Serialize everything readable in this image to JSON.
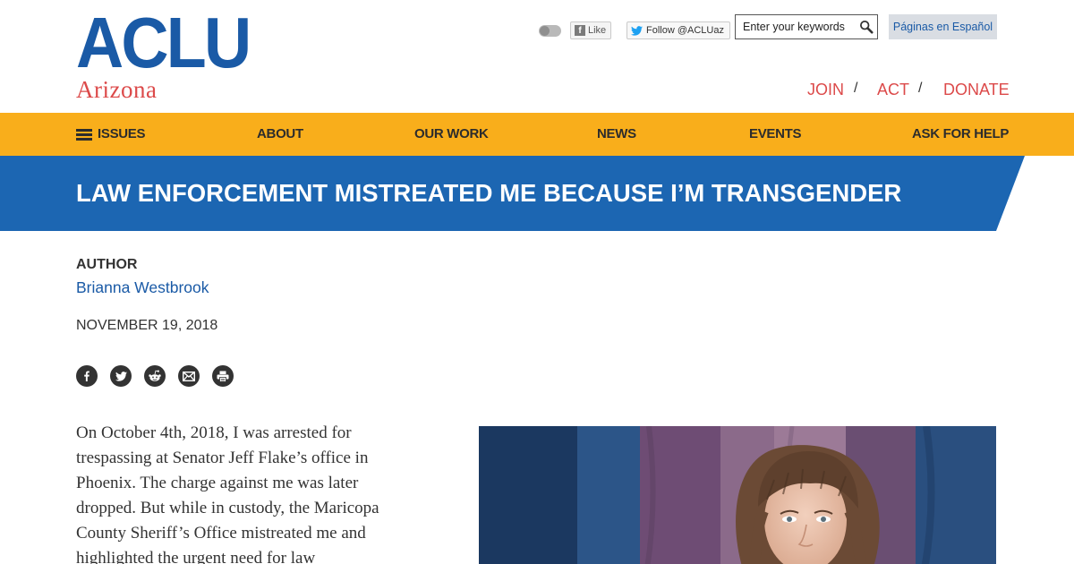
{
  "header": {
    "logo_main": "ACLU",
    "logo_sub": "Arizona",
    "facebook_label": "Like",
    "twitter_label": "Follow @ACLUaz",
    "search_placeholder": "Enter your keywords",
    "spanish_link": "Páginas en Español",
    "action_links": [
      "JOIN",
      "ACT",
      "DONATE"
    ],
    "separator": "/"
  },
  "nav": {
    "items": [
      "ISSUES",
      "ABOUT",
      "OUR WORK",
      "NEWS",
      "EVENTS",
      "ASK FOR HELP"
    ]
  },
  "article": {
    "title": "LAW ENFORCEMENT MISTREATED ME BECAUSE I’M TRANSGENDER",
    "author_label": "AUTHOR",
    "author_name": "Brianna Westbrook",
    "date": "NOVEMBER 19, 2018",
    "share_icons": [
      "facebook-icon",
      "twitter-icon",
      "reddit-icon",
      "email-icon",
      "print-icon"
    ],
    "body_lines": [
      "On October 4th, 2018, I was arrested for",
      "trespassing at Senator Jeff Flake’s office in",
      "Phoenix. The charge against me was later",
      "dropped. But while in custody, the Maricopa",
      "County Sheriff’s Office mistreated me and",
      "highlighted the urgent need for law"
    ]
  },
  "colors": {
    "brand_blue": "#1a5aa6",
    "title_band": "#1c66b2",
    "nav_yellow": "#f9ae1b",
    "accent_red": "#dc4a4a"
  }
}
